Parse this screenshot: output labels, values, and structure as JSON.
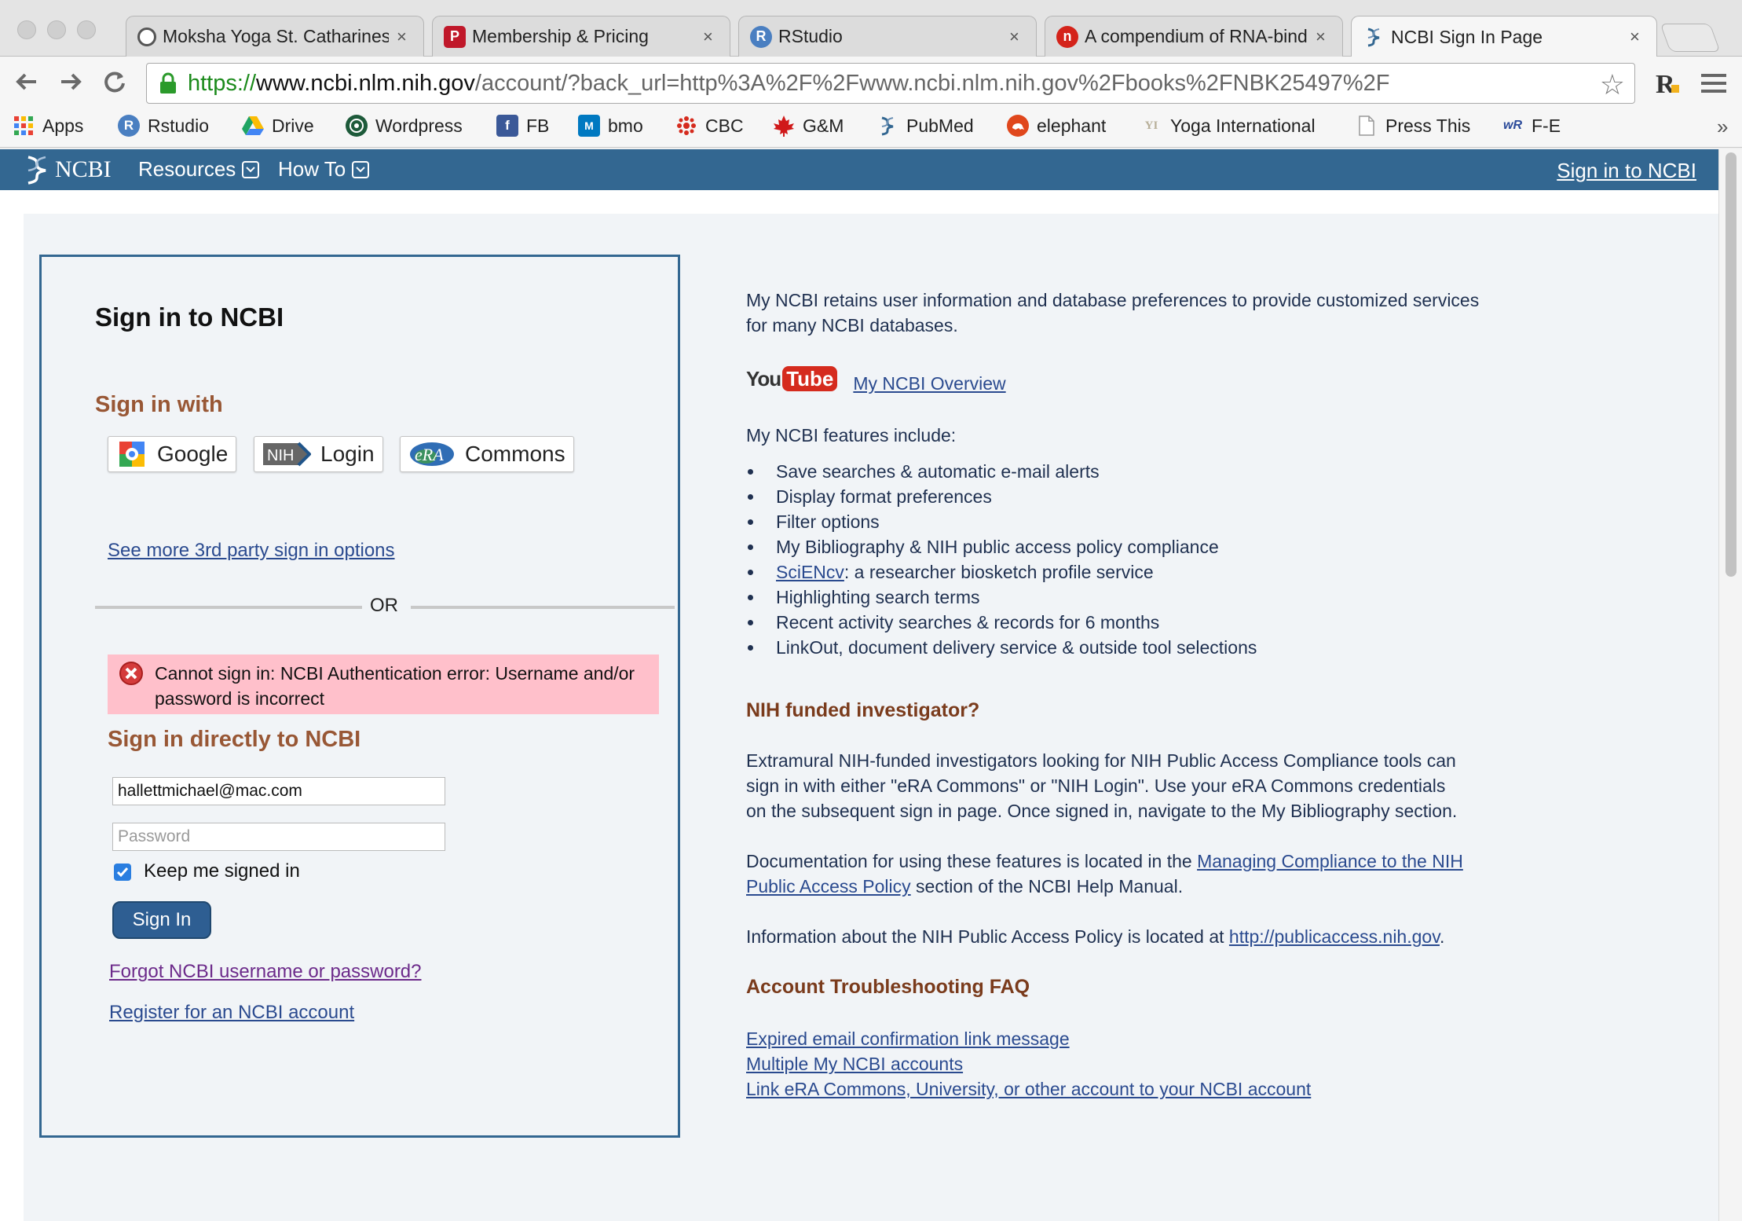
{
  "browser": {
    "tabs": [
      {
        "label": "Moksha Yoga St. Catharines",
        "close": "×",
        "favicon_color": "#555555"
      },
      {
        "label": "Membership & Pricing",
        "close": "×",
        "favicon_color": "#c0182a",
        "favicon_letter": "P"
      },
      {
        "label": "RStudio",
        "close": "×",
        "favicon_color": "#4a7fc1",
        "favicon_letter": "R"
      },
      {
        "label": "A compendium of RNA-binding",
        "close": "×",
        "favicon_color": "#d4231a",
        "favicon_letter": "n"
      },
      {
        "label": "NCBI Sign In Page",
        "close": "×",
        "favicon_color": "#336791",
        "favicon_letter": ""
      }
    ],
    "url": {
      "scheme": "https://",
      "host": "www.ncbi.nlm.nih.gov",
      "rest": "/account/?back_url=http%3A%2F%2Fwww.ncbi.nlm.nih.gov%2Fbooks%2FNBK25497%2F"
    },
    "bookmarks": [
      {
        "label": "Apps",
        "color": "#e94235",
        "letter": ""
      },
      {
        "label": "Rstudio",
        "color": "#4a7fc1",
        "letter": "R"
      },
      {
        "label": "Drive",
        "color": "#1fa463",
        "letter": ""
      },
      {
        "label": "Wordpress",
        "color": "#1d5a3a",
        "letter": ""
      },
      {
        "label": "FB",
        "color": "#3b5998",
        "letter": "f"
      },
      {
        "label": "bmo",
        "color": "#0079c1",
        "letter": "M"
      },
      {
        "label": "CBC",
        "color": "#d52b1e",
        "letter": ""
      },
      {
        "label": "G&M",
        "color": "#d0191a",
        "letter": ""
      },
      {
        "label": "PubMed",
        "color": "#336791",
        "letter": ""
      },
      {
        "label": "elephant",
        "color": "#e0471c",
        "letter": ""
      },
      {
        "label": "Yoga International",
        "color": "#b8b09a",
        "letter": "YI"
      },
      {
        "label": "Press This",
        "color": "#cccccc",
        "letter": ""
      },
      {
        "label": "F-E",
        "color": "#2a4a9a",
        "letter": "wR"
      }
    ],
    "bookmarks_overflow": "»"
  },
  "ncbi_header": {
    "logo": "NCBI",
    "menu": [
      "Resources",
      "How To"
    ],
    "sign_in_link": "Sign in to NCBI"
  },
  "signin": {
    "title": "Sign in to NCBI",
    "sign_in_with": "Sign in with",
    "providers": [
      "Google",
      "Login",
      "Commons"
    ],
    "provider_badges": {
      "nih": "NIH",
      "era": "eRA"
    },
    "more_options": "See more 3rd party sign in options",
    "or": "OR",
    "error": "Cannot sign in: NCBI Authentication error: Username and/or password is incorrect",
    "direct_heading": "Sign in directly to NCBI",
    "username_value": "hallettmichael@mac.com",
    "password_placeholder": "Password",
    "keep_signed_in": "Keep me signed in",
    "keep_signed_in_checked": true,
    "button": "Sign In",
    "forgot": "Forgot NCBI username or password?",
    "register": "Register for an NCBI account"
  },
  "info": {
    "intro": "My NCBI retains user information and database preferences to provide customized services for many NCBI databases.",
    "youtube_you": "You",
    "youtube_tube": "Tube",
    "overview_link": "My NCBI Overview",
    "features_intro": "My NCBI features include:",
    "features": [
      "Save searches & automatic e-mail alerts",
      "Display format preferences",
      "Filter options",
      "My Bibliography & NIH public access policy compliance",
      "Highlighting search terms",
      "Recent activity searches & records for 6 months",
      "LinkOut, document delivery service & outside tool selections"
    ],
    "sciencv_link": "SciENcv",
    "sciencv_rest": ": a researcher biosketch profile service",
    "nih_heading": "NIH funded investigator?",
    "nih_text": "Extramural NIH-funded investigators looking for NIH Public Access Compliance tools can sign in with either \"eRA Commons\" or \"NIH Login\". Use your eRA Commons credentials on the subsequent sign in page. Once signed in, navigate to the My Bibliography section.",
    "doc_text_1": "Documentation for using these features is located in the ",
    "doc_link": "Managing Compliance to the NIH Public Access Policy",
    "doc_text_2": " section of the NCBI Help Manual.",
    "policy_text": "Information about the NIH Public Access Policy is located at ",
    "policy_link": "http://publicaccess.nih.gov",
    "policy_end": ".",
    "faq_heading": "Account Troubleshooting FAQ",
    "faq_links": [
      "Expired email confirmation link message",
      "Multiple My NCBI accounts",
      "Link eRA Commons, University, or other account to your NCBI account"
    ]
  }
}
